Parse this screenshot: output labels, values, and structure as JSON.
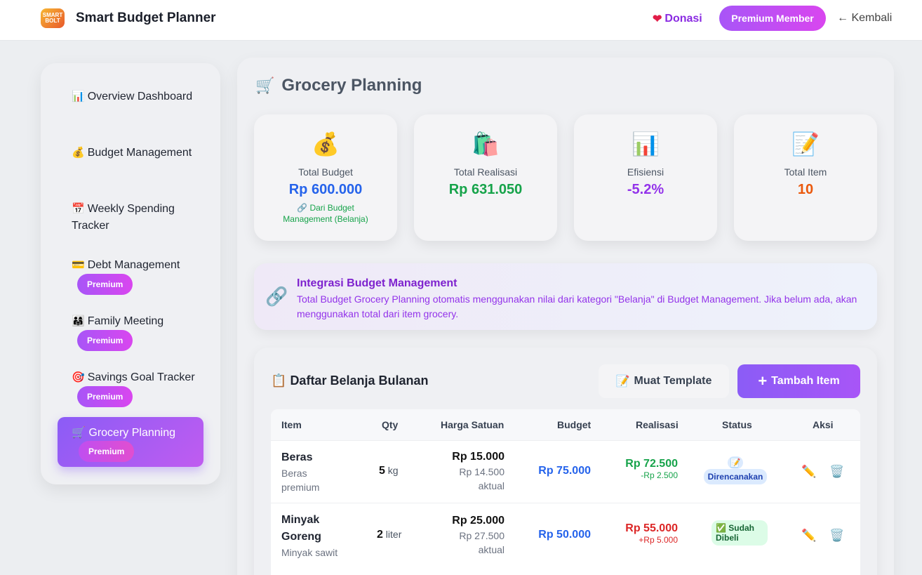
{
  "header": {
    "logo_text": "SMART BOLT",
    "app_title": "Smart Budget Planner",
    "donasi": "Donasi",
    "premium": "Premium Member",
    "back": "← Kembali"
  },
  "sidebar": {
    "items": [
      {
        "icon": "📊",
        "label": "Overview Dashboard",
        "premium": ""
      },
      {
        "icon": "💰",
        "label": "Budget Management",
        "premium": ""
      },
      {
        "icon": "📅",
        "label": "Weekly Spending Tracker",
        "premium": ""
      },
      {
        "icon": "💳",
        "label": "Debt Management",
        "premium": "Premium"
      },
      {
        "icon": "👨‍👩‍👧",
        "label": "Family Meeting",
        "premium": "Premium"
      },
      {
        "icon": "🎯",
        "label": "Savings Goal Tracker",
        "premium": "Premium"
      },
      {
        "icon": "🛒",
        "label": "Grocery Planning",
        "premium": "Premium"
      }
    ]
  },
  "page": {
    "icon": "🛒",
    "title": "Grocery Planning"
  },
  "stats": [
    {
      "icon": "💰",
      "label": "Total Budget",
      "value": "Rp 600.000",
      "color": "#2563eb",
      "note": "🔗 Dari Budget Management (Belanja)"
    },
    {
      "icon": "🛍️",
      "label": "Total Realisasi",
      "value": "Rp 631.050",
      "color": "#16a34a",
      "note": ""
    },
    {
      "icon": "📊",
      "label": "Efisiensi",
      "value": "-5.2%",
      "color": "#9333ea",
      "note": ""
    },
    {
      "icon": "📝",
      "label": "Total Item",
      "value": "10",
      "color": "#ea580c",
      "note": ""
    }
  ],
  "integration": {
    "icon": "🔗",
    "title": "Integrasi Budget Management",
    "desc": "Total Budget Grocery Planning otomatis menggunakan nilai dari kategori \"Belanja\" di Budget Management. Jika belum ada, akan menggunakan total dari item grocery."
  },
  "list": {
    "icon": "📋",
    "title": "Daftar Belanja Bulanan",
    "template_btn": "Muat Template",
    "template_icon": "📝",
    "add_btn": "Tambah Item",
    "columns": [
      "Item",
      "Qty",
      "Harga Satuan",
      "Budget",
      "Realisasi",
      "Status",
      "Aksi"
    ],
    "rows": [
      {
        "name": "Beras",
        "desc": "Beras premium",
        "qty": "5",
        "unit": "kg",
        "price": "Rp 15.000",
        "actual": "Rp 14.500 aktual",
        "budget": "Rp 75.000",
        "real": "Rp 72.500",
        "diff": "-Rp 2.500",
        "status_icon": "📝",
        "status": "Direncanakan"
      },
      {
        "name": "Minyak Goreng",
        "desc": "Minyak sawit",
        "qty": "2",
        "unit": "liter",
        "price": "Rp 25.000",
        "actual": "Rp 27.500 aktual",
        "budget": "Rp 50.000",
        "real": "Rp 55.000",
        "diff": "+Rp 5.000",
        "status_icon": "✅",
        "status": "Sudah Dibeli"
      }
    ]
  }
}
